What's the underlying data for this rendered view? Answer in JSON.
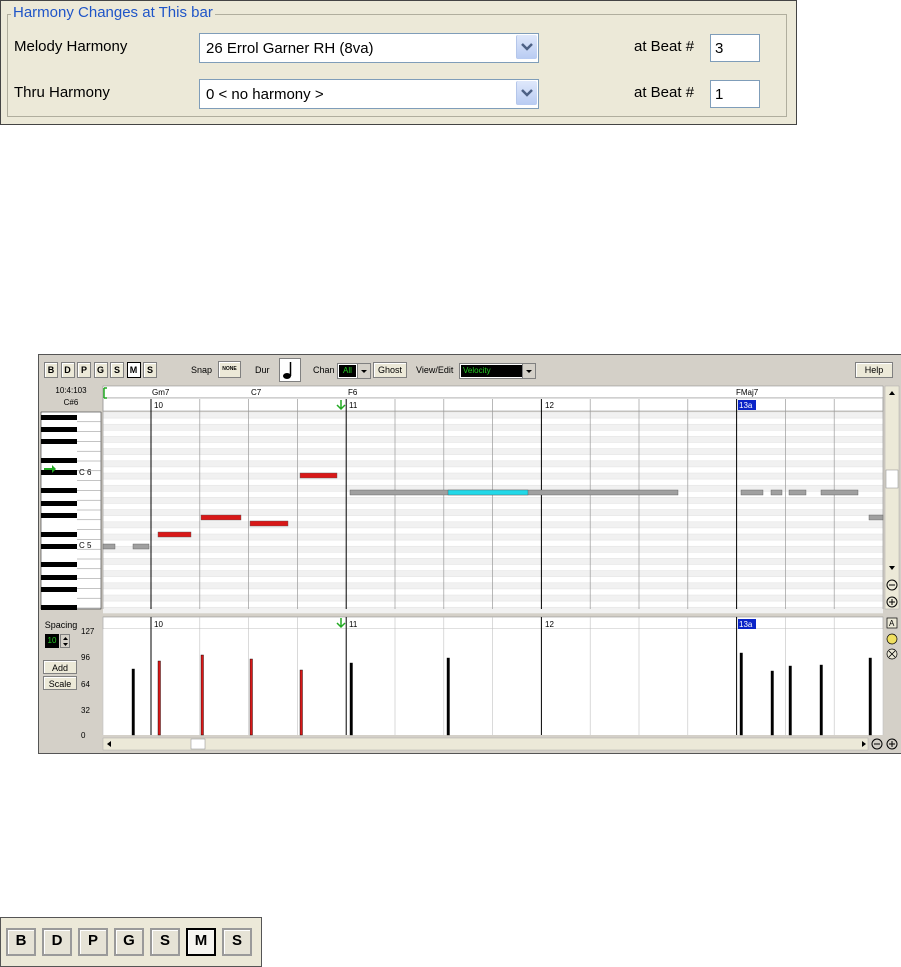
{
  "harmony_panel": {
    "title": "Harmony Changes at This bar",
    "melody_label": "Melody Harmony",
    "melody_value": "26 Errol Garner RH (8va)",
    "thru_label": "Thru Harmony",
    "thru_value": "0 < no harmony >",
    "beat_label": "at Beat #",
    "melody_beat": "3",
    "thru_beat": "1"
  },
  "piano_roll": {
    "track_buttons": [
      {
        "label": "B",
        "pressed": false
      },
      {
        "label": "D",
        "pressed": false
      },
      {
        "label": "P",
        "pressed": false
      },
      {
        "label": "G",
        "pressed": false
      },
      {
        "label": "S",
        "pressed": false
      },
      {
        "label": "M",
        "pressed": true
      },
      {
        "label": "S",
        "pressed": false
      }
    ],
    "snap_label": "Snap",
    "snap_value": "NONE",
    "dur_label": "Dur",
    "chan_label": "Chan",
    "chan_value": "All",
    "ghost_label": "Ghost",
    "view_edit_label": "View/Edit",
    "view_edit_value": "Velocity",
    "help_label": "Help",
    "time_position": "10:4:103",
    "note_position": "C#6",
    "chords": [
      "Gm7",
      "C7",
      "F6",
      "FMaj7"
    ],
    "bars": [
      "10",
      "11",
      "12",
      "13a"
    ],
    "octave_labels": [
      "C 6",
      "C 5"
    ],
    "spacing_label": "Spacing",
    "spacing_value": "10",
    "add_label": "Add",
    "scale_label": "Scale",
    "velocity_ticks": [
      "127",
      "96",
      "64",
      "32",
      "0"
    ],
    "colors": {
      "melody_note": "#d81818",
      "other_note": "#a0a0a0",
      "selected_note": "#22d8e8",
      "chan_bg": "#000000",
      "chan_text": "#22cc22",
      "bar13_highlight": "#0a24c8"
    }
  },
  "track_bar": {
    "buttons": [
      {
        "label": "B",
        "pressed": false
      },
      {
        "label": "D",
        "pressed": false
      },
      {
        "label": "P",
        "pressed": false
      },
      {
        "label": "G",
        "pressed": false
      },
      {
        "label": "S",
        "pressed": false
      },
      {
        "label": "M",
        "pressed": true
      },
      {
        "label": "S",
        "pressed": false
      }
    ]
  }
}
